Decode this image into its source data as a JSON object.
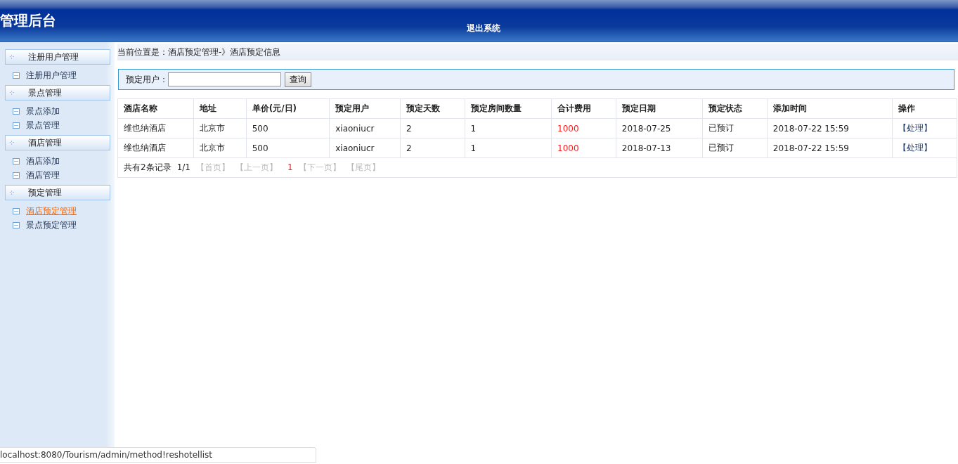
{
  "header": {
    "title": "管理后台",
    "logout": "退出系统"
  },
  "sidebar": [
    {
      "label": "注册用户管理",
      "items": [
        {
          "label": "注册用户管理",
          "selected": false
        }
      ]
    },
    {
      "label": "景点管理",
      "items": [
        {
          "label": "景点添加",
          "selected": false
        },
        {
          "label": "景点管理",
          "selected": false
        }
      ]
    },
    {
      "label": "酒店管理",
      "items": [
        {
          "label": "酒店添加",
          "selected": false
        },
        {
          "label": "酒店管理",
          "selected": false
        }
      ]
    },
    {
      "label": "预定管理",
      "items": [
        {
          "label": "酒店预定管理",
          "selected": true
        },
        {
          "label": "景点预定管理",
          "selected": false
        }
      ]
    }
  ],
  "breadcrumb": "当前位置是：酒店预定管理-》酒店预定信息",
  "search": {
    "label": "预定用户：",
    "button": "查询"
  },
  "table": {
    "columns": [
      {
        "label": "酒店名称",
        "accent": false
      },
      {
        "label": "地址",
        "accent": false
      },
      {
        "label": "单价(元/日)",
        "accent": false
      },
      {
        "label": "预定用户",
        "accent": false
      },
      {
        "label": "预定天数",
        "accent": false
      },
      {
        "label": "预定房间数量",
        "accent": false
      },
      {
        "label": "合计费用",
        "accent": true
      },
      {
        "label": "预定日期",
        "accent": false
      },
      {
        "label": "预定状态",
        "accent": false
      },
      {
        "label": "添加时间",
        "accent": false
      },
      {
        "label": "操作",
        "accent": false
      }
    ],
    "rows": [
      [
        "维也纳酒店",
        "北京市",
        "500",
        "xiaoniucr",
        "2",
        "1",
        "1000",
        "2018-07-25",
        "已预订",
        "2018-07-22 15:59",
        "【处理】"
      ],
      [
        "维也纳酒店",
        "北京市",
        "500",
        "xiaoniucr",
        "2",
        "1",
        "1000",
        "2018-07-13",
        "已预订",
        "2018-07-22 15:59",
        "【处理】"
      ]
    ]
  },
  "pager": {
    "summary": "共有2条记录",
    "pages": "1/1",
    "links": [
      {
        "label": "【首页】",
        "kind": "link",
        "disabled": true
      },
      {
        "label": "【上一页】",
        "kind": "link",
        "disabled": true
      },
      {
        "label": "1",
        "kind": "current"
      },
      {
        "label": "【下一页】",
        "kind": "link",
        "disabled": true
      },
      {
        "label": "【尾页】",
        "kind": "link",
        "disabled": true
      }
    ]
  },
  "status_url": "localhost:8080/Tourism/admin/method!reshotellist"
}
